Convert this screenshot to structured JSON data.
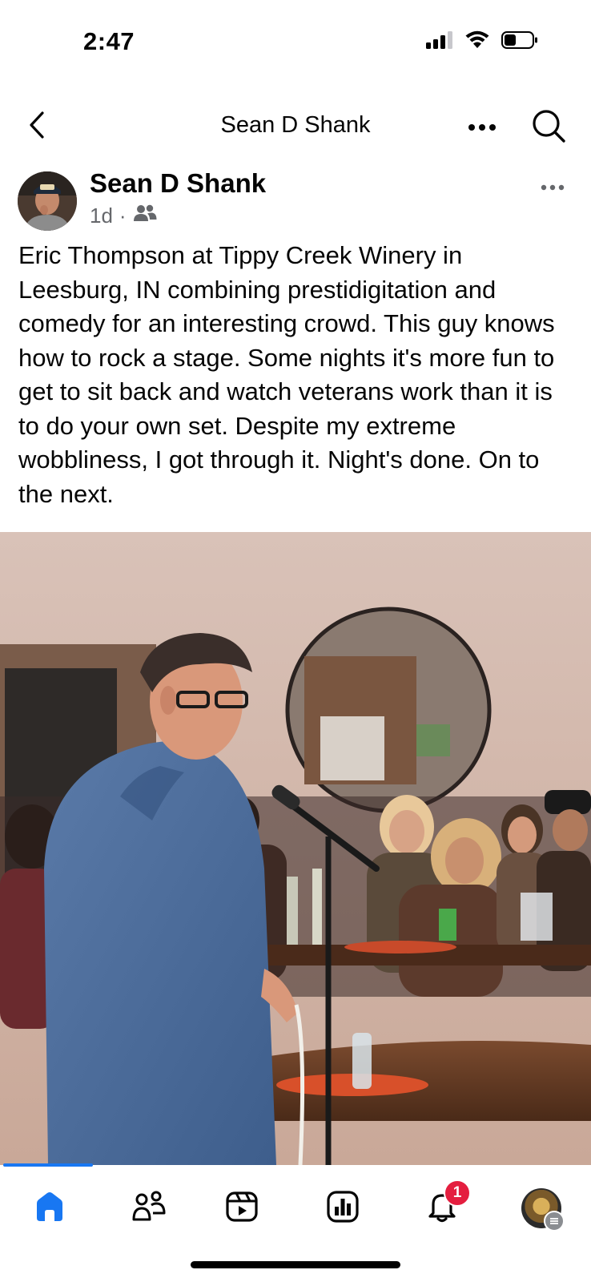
{
  "status_bar": {
    "time": "2:47",
    "icons": [
      "cellular-signal-icon",
      "wifi-icon",
      "battery-icon"
    ]
  },
  "header": {
    "title": "Sean D Shank",
    "icons": [
      "back-chevron-icon",
      "more-horizontal-icon",
      "search-icon"
    ]
  },
  "post": {
    "author": "Sean D Shank",
    "time_ago": "1d",
    "separator": "·",
    "audience_icon": "friends-icon",
    "text": "Eric Thompson at Tippy Creek Winery in Leesburg, IN combining prestidigitation and comedy for an interesting crowd. This guy knows how to rock a stage. Some nights it's more fun to get to sit back and watch veterans work than it is to do your own set. Despite my extreme wobbliness, I got through it. Night's done. On to the next.",
    "photo_progress": 0.15
  },
  "tab_bar": {
    "tabs": [
      {
        "name": "home",
        "icon": "home-icon",
        "active": true
      },
      {
        "name": "friends",
        "icon": "friends-icon",
        "active": false
      },
      {
        "name": "video",
        "icon": "video-icon",
        "active": false
      },
      {
        "name": "dashboard",
        "icon": "dashboard-icon",
        "active": false
      },
      {
        "name": "notifications",
        "icon": "bell-icon",
        "active": false
      },
      {
        "name": "profile",
        "icon": "profile-avatar-icon",
        "active": false
      }
    ],
    "notification_count": "1"
  },
  "colors": {
    "accent": "#1877f2",
    "badge": "#e41e3f",
    "secondary_text": "#65676b"
  }
}
